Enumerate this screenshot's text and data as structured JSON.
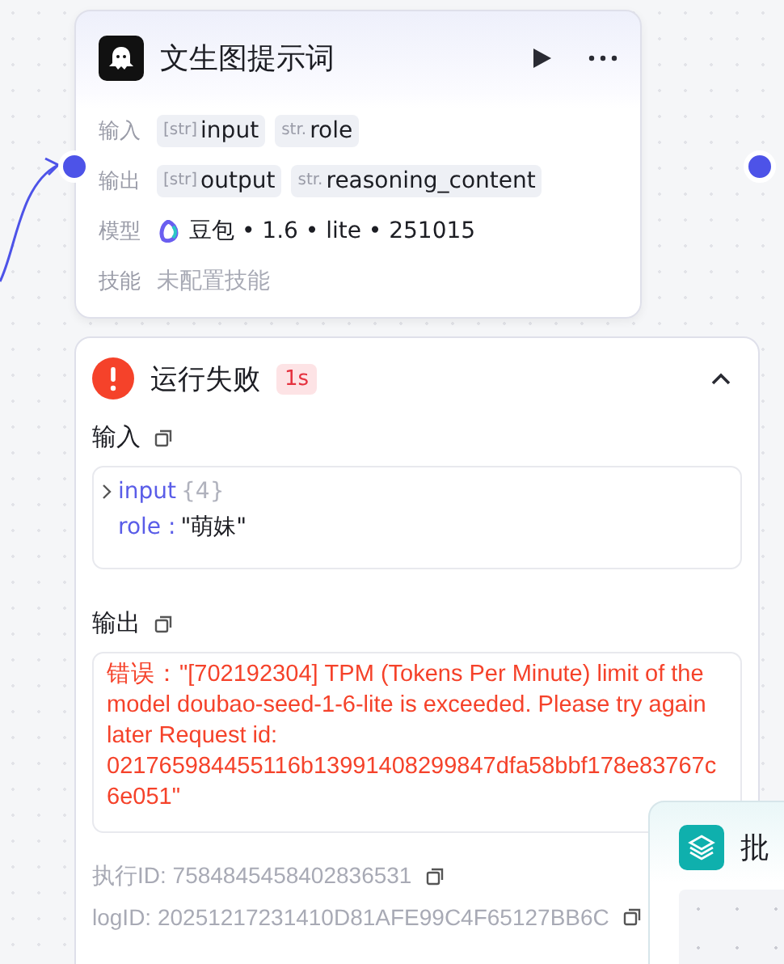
{
  "node": {
    "title": "文生图提示词",
    "rows": [
      {
        "kind": "params",
        "label": "输入",
        "params": [
          {
            "type": "[str]",
            "name": "input"
          },
          {
            "type": "str.",
            "name": "role"
          }
        ]
      },
      {
        "kind": "params",
        "label": "输出",
        "params": [
          {
            "type": "[str]",
            "name": "output"
          },
          {
            "type": "str.",
            "name": "reasoning_content"
          }
        ]
      },
      {
        "kind": "model",
        "label": "模型",
        "value": "豆包 • 1.6 • lite • 251015"
      },
      {
        "kind": "empty",
        "label": "技能",
        "value": "未配置技能"
      }
    ]
  },
  "result": {
    "status": "运行失败",
    "duration": "1s",
    "expanded": true,
    "input_label": "输入",
    "input_tree": [
      {
        "key": "input",
        "count": "{4}",
        "expanded": false
      },
      {
        "key": "role :",
        "value": "\"萌妹\""
      }
    ],
    "output_label": "输出",
    "error": "错误：\"[702192304] TPM (Tokens Per Minute) limit of the model doubao-seed-1-6-lite is exceeded. Please try again later Request id: 021765984455116b13991408299847dfa58bbf178e83767c6e051\"",
    "exec_id": "执行ID: 7584845458402836531",
    "log_id": "logID: 20251217231410D81AFE99C4F65127BB6C"
  },
  "batch_node": {
    "title": "批"
  }
}
